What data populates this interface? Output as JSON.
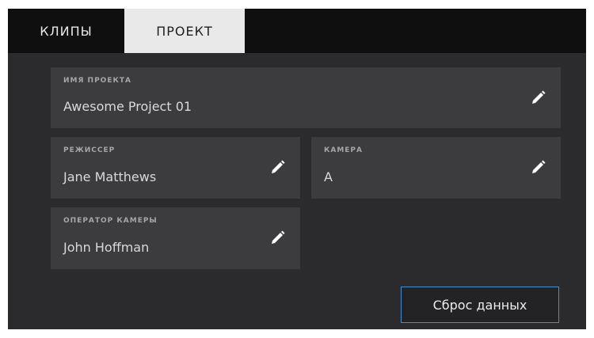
{
  "tabs": [
    {
      "label": "КЛИПЫ",
      "active": false
    },
    {
      "label": "ПРОЕКТ",
      "active": true
    }
  ],
  "fields": {
    "project_name": {
      "label": "ИМЯ ПРОЕКТА",
      "value": "Awesome Project 01"
    },
    "director": {
      "label": "РЕЖИССЕР",
      "value": "Jane Matthews"
    },
    "camera": {
      "label": "КАМЕРА",
      "value": "A"
    },
    "camera_operator": {
      "label": "ОПЕРАТОР КАМЕРЫ",
      "value": "John Hoffman"
    }
  },
  "reset_button": {
    "label": "Сброс данных"
  },
  "icons": {
    "edit": "pencil-icon"
  },
  "colors": {
    "accent": "#4a8ec8",
    "active_tab": "#e9e9ea",
    "panel": "#3c3c3f",
    "background": "#2b2b2d"
  }
}
